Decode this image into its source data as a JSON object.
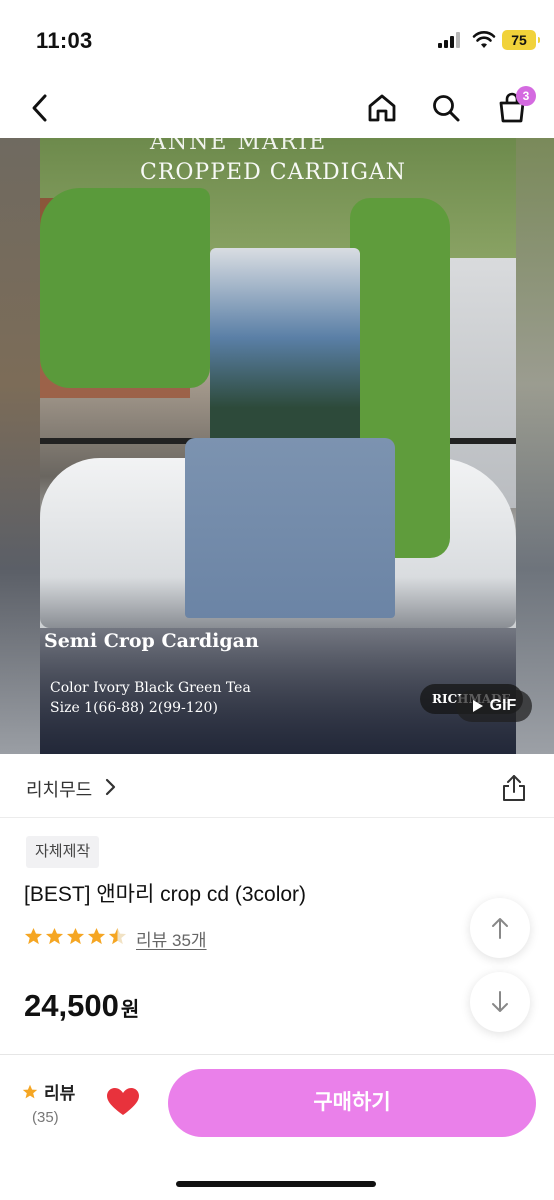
{
  "status_bar": {
    "time": "11:03",
    "battery": "75"
  },
  "nav": {
    "cart_badge": "3"
  },
  "hero": {
    "overlay_title_1": "ANNE MARIE",
    "overlay_title_2": "CROPPED CARDIGAN",
    "overlay_subtitle": "Semi Crop Cardigan",
    "overlay_color": "Color Ivory Black Green Tea",
    "overlay_size": "Size 1(66-88) 2(99-120)",
    "brand_watermark": "RICHMADE",
    "gif_label": "GIF"
  },
  "seller": {
    "name": "리치무드"
  },
  "product": {
    "tag": "자체제작",
    "title": "[BEST] 앤마리 crop cd (3color)",
    "rating": 4.5,
    "review_link": "리뷰 35개",
    "price": "24,500",
    "currency": "원"
  },
  "bottom_bar": {
    "review_label": "리뷰",
    "review_count": "(35)",
    "buy_label": "구매하기"
  },
  "colors": {
    "accent": "#ea80ea",
    "badge": "#d46ae0",
    "star": "#f5a623",
    "heart": "#e8323c"
  }
}
